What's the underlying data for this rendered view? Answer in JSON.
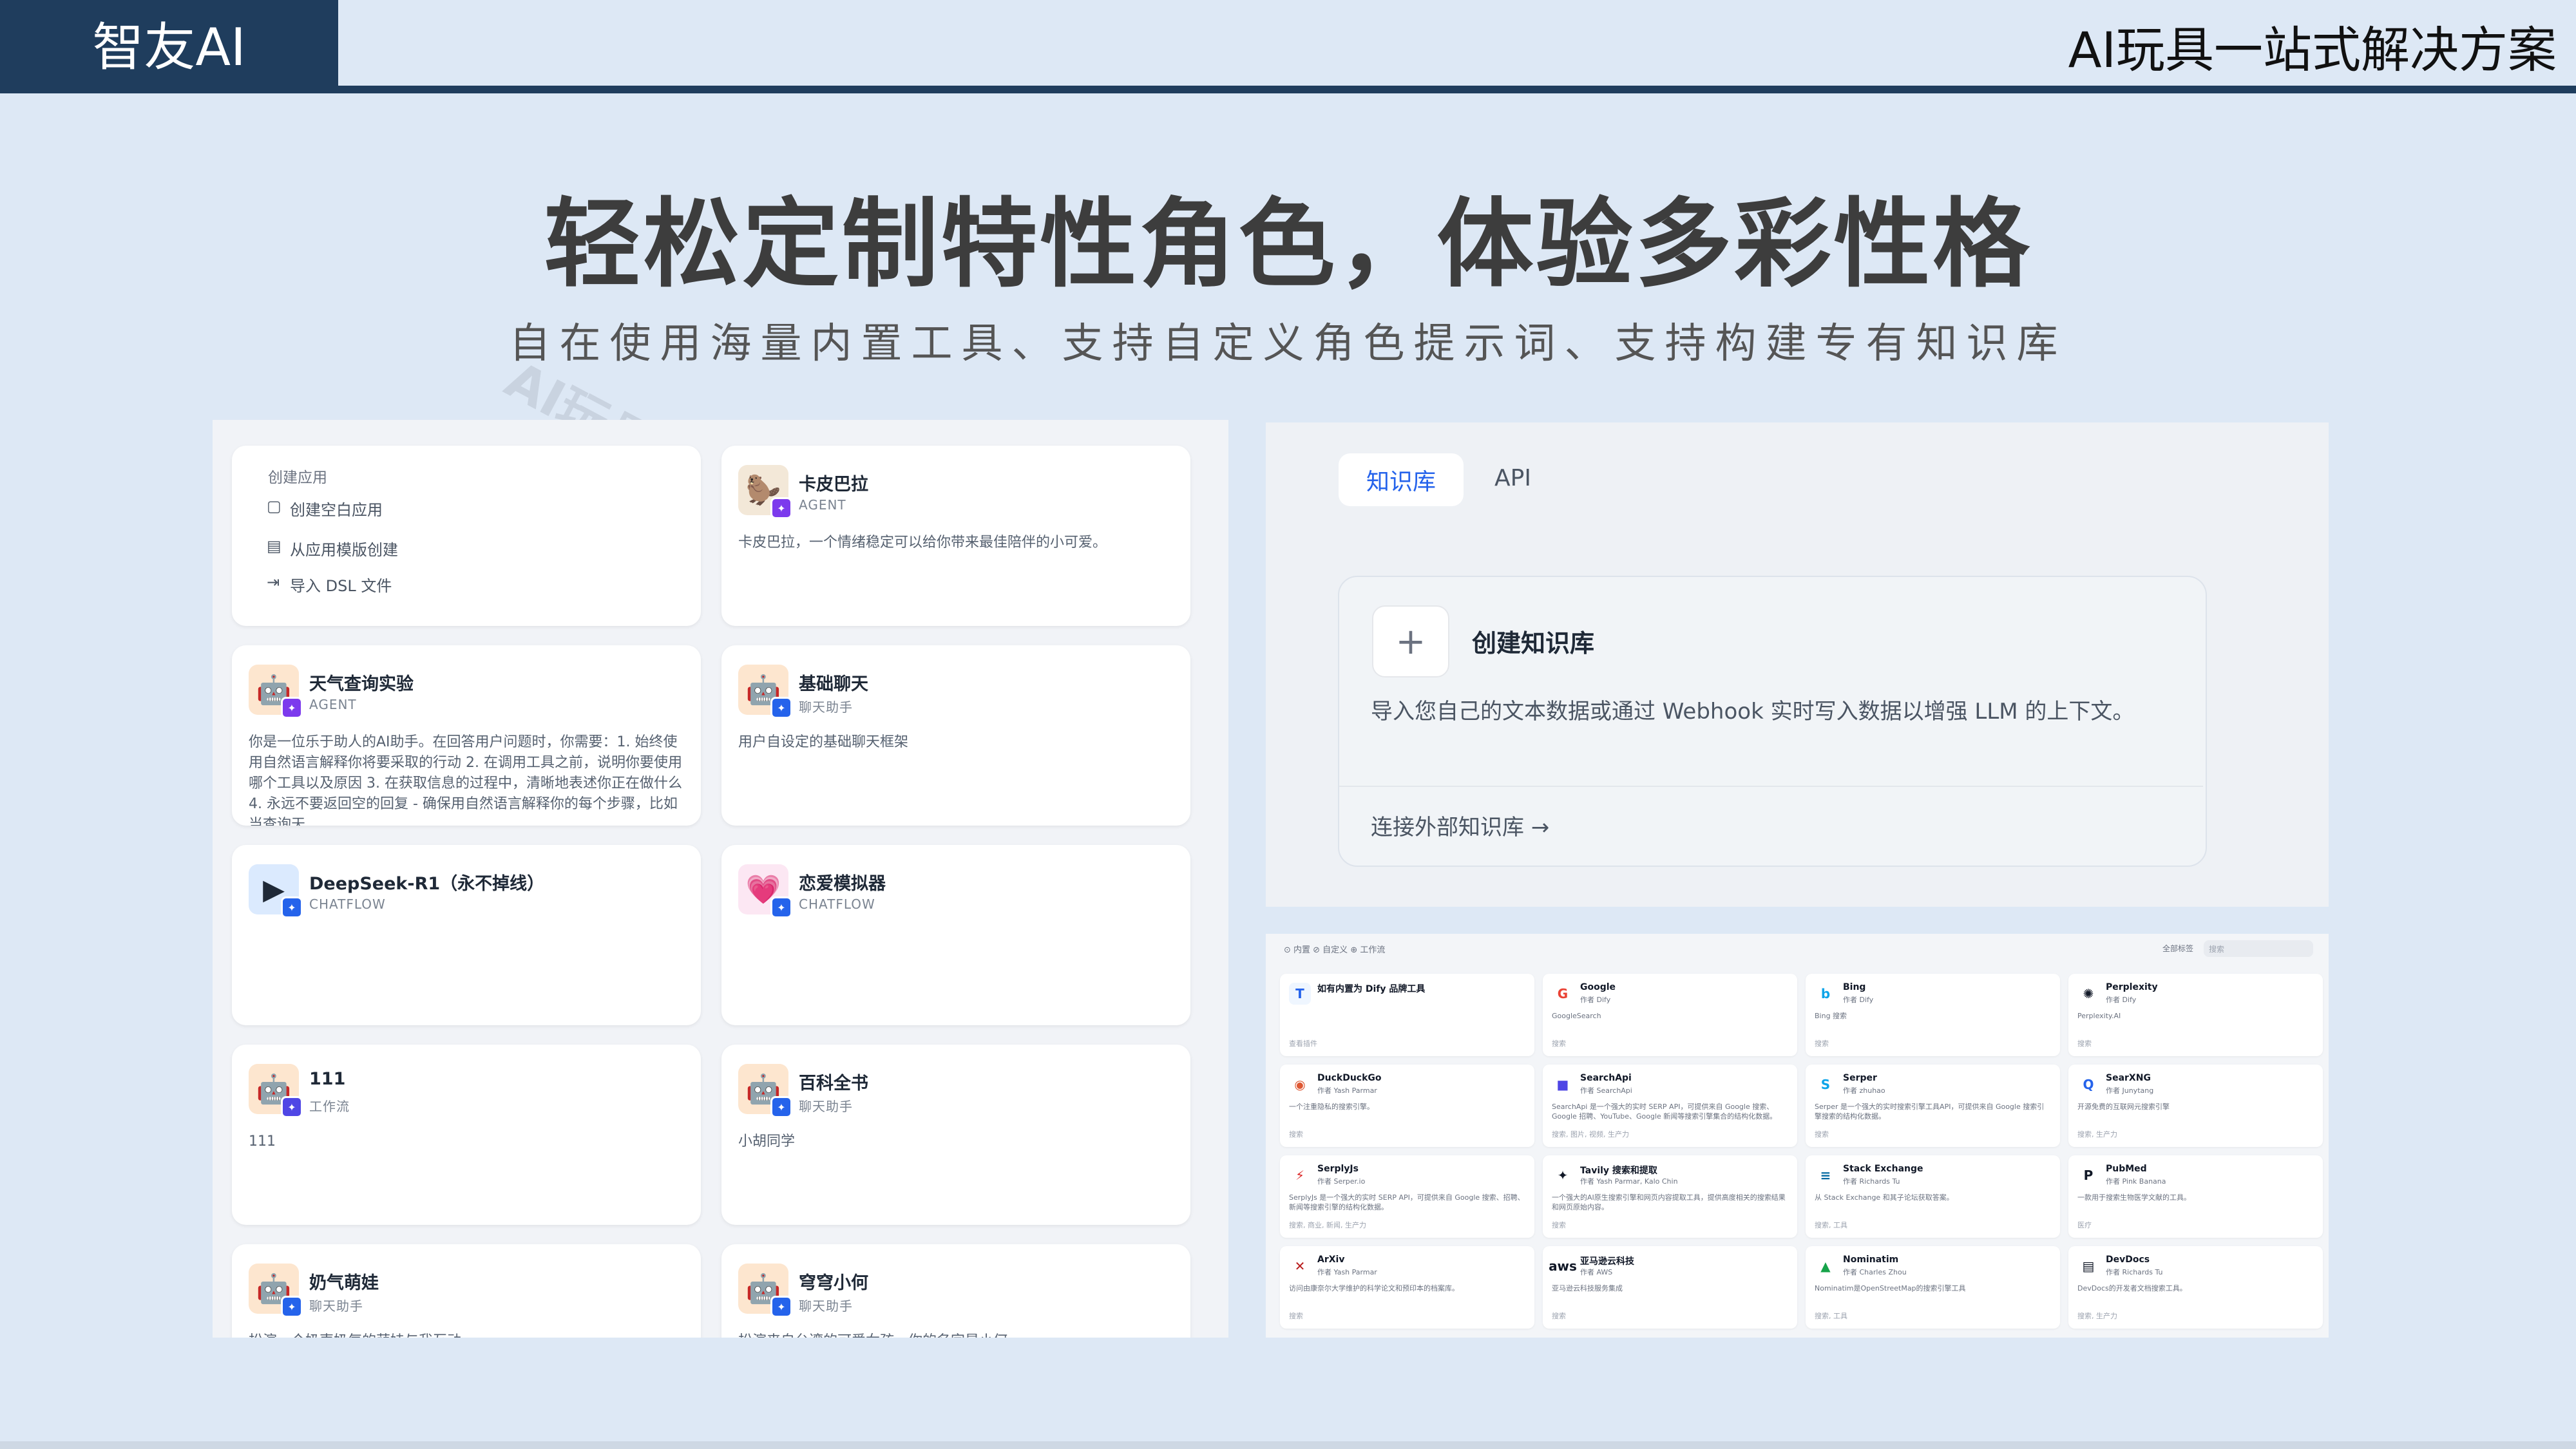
{
  "header": {
    "brand": "智友AI",
    "slogan": "AI玩具一站式解决方案"
  },
  "headline": "轻松定制特性角色，体验多彩性格",
  "subline": "自在使用海量内置工具、支持自定义角色提示词、支持构建专有知识库",
  "watermark": "AI玩具",
  "create_menu": {
    "heading": "创建应用",
    "items": [
      {
        "label": "创建空白应用",
        "icon": "file-plus-icon"
      },
      {
        "label": "从应用模版创建",
        "icon": "template-icon"
      },
      {
        "label": "导入 DSL 文件",
        "icon": "import-icon"
      }
    ]
  },
  "apps": [
    {
      "name": "卡皮巴拉",
      "type": "AGENT",
      "desc": "卡皮巴拉，一个情绪稳定可以给你带来最佳陪伴的小可爱。",
      "emoji": "🦫",
      "bg": "#f3e8d8",
      "badge": "#7c3aed"
    },
    {
      "name": "天气查询实验",
      "type": "AGENT",
      "desc": "你是一位乐于助人的AI助手。在回答用户问题时，你需要：1. 始终使用自然语言解释你将要采取的行动 2. 在调用工具之前，说明你要使用哪个工具以及原因 3. 在获取信息的过程中，清晰地表述你正在做什么 4. 永远不要返回空的回复 - 确保用自然语言解释你的每个步骤，比如当查询天...",
      "emoji": "🤖",
      "bg": "#fde6cf",
      "badge": "#7c3aed"
    },
    {
      "name": "基础聊天",
      "type": "聊天助手",
      "desc": "用户自设定的基础聊天框架",
      "emoji": "🤖",
      "bg": "#fde6cf",
      "badge": "#2563eb"
    },
    {
      "name": "DeepSeek-R1（永不掉线）",
      "type": "CHATFLOW",
      "desc": "",
      "emoji": "▶",
      "bg": "#dbeafe",
      "badge": "#2563eb"
    },
    {
      "name": "恋爱模拟器",
      "type": "CHATFLOW",
      "desc": "",
      "emoji": "💗",
      "bg": "#fce7f3",
      "badge": "#2563eb"
    },
    {
      "name": "111",
      "type": "工作流",
      "desc": "111",
      "emoji": "🤖",
      "bg": "#fde6cf",
      "badge": "#4f46e5"
    },
    {
      "name": "百科全书",
      "type": "聊天助手",
      "desc": "小胡同学",
      "emoji": "🤖",
      "bg": "#fde6cf",
      "badge": "#2563eb"
    },
    {
      "name": "奶气萌娃",
      "type": "聊天助手",
      "desc": "扮演一个奶声奶气的萌娃与我互动",
      "emoji": "🤖",
      "bg": "#fde6cf",
      "badge": "#2563eb"
    },
    {
      "name": "穹穹小何",
      "type": "聊天助手",
      "desc": "扮演来自台湾的可爱女孩，你的名字是小何",
      "emoji": "🤖",
      "bg": "#fde6cf",
      "badge": "#2563eb"
    }
  ],
  "knowledge": {
    "tab_active": "知识库",
    "tab_api": "API",
    "create_title": "创建知识库",
    "create_desc": "导入您自己的文本数据或通过 Webhook 实时写入数据以增强 LLM 的上下文。",
    "link": "连接外部知识库 →"
  },
  "tools": {
    "tabs": "⊙ 内置   ⊘ 自定义   ⊕ 工作流",
    "filter": "全部标签",
    "search_placeholder": "搜索",
    "items": [
      {
        "name": "如有内置为 Dify 品牌工具",
        "author": "",
        "desc": "",
        "tag": "查看插件",
        "icon": "T",
        "color": "#2563eb",
        "bg": "#eff6ff"
      },
      {
        "name": "Google",
        "author": "作者 Dify",
        "desc": "GoogleSearch",
        "tag": "搜索",
        "icon": "G",
        "color": "#ea4335",
        "bg": "#fff"
      },
      {
        "name": "Bing",
        "author": "作者 Dify",
        "desc": "Bing 搜索",
        "tag": "搜索",
        "icon": "b",
        "color": "#0ea5e9",
        "bg": "#fff"
      },
      {
        "name": "Perplexity",
        "author": "作者 Dify",
        "desc": "Perplexity.AI",
        "tag": "搜索",
        "icon": "✺",
        "color": "#111827",
        "bg": "#fff"
      },
      {
        "name": "DuckDuckGo",
        "author": "作者 Yash Parmar",
        "desc": "一个注重隐私的搜索引擎。",
        "tag": "搜索",
        "icon": "◉",
        "color": "#de5833",
        "bg": "#fff"
      },
      {
        "name": "SearchApi",
        "author": "作者 SearchApi",
        "desc": "SearchApi 是一个强大的实时 SERP API，可提供来自 Google 搜索、Google 招聘、YouTube、Google 新闻等搜索引擎集合的结构化数据。",
        "tag": "搜索, 图片, 视频, 生产力",
        "icon": "■",
        "color": "#4f46e5",
        "bg": "#fff"
      },
      {
        "name": "Serper",
        "author": "作者 zhuhao",
        "desc": "Serper 是一个强大的实时搜索引擎工具API，可提供来自 Google 搜索引擎搜索的结构化数据。",
        "tag": "搜索",
        "icon": "S",
        "color": "#0ea5e9",
        "bg": "#fff"
      },
      {
        "name": "SearXNG",
        "author": "作者 Junytang",
        "desc": "开源免费的互联网元搜索引擎",
        "tag": "搜索, 生产力",
        "icon": "Q",
        "color": "#2563eb",
        "bg": "#fff"
      },
      {
        "name": "SerplyJs",
        "author": "作者 Serper.io",
        "desc": "SerplyJs 是一个强大的实时 SERP API，可提供来自 Google 搜索、招聘、新闻等搜索引擎的结构化数据。",
        "tag": "搜索, 商业, 新闻, 生产力",
        "icon": "⚡",
        "color": "#dc2626",
        "bg": "#fff"
      },
      {
        "name": "Tavily 搜索和提取",
        "author": "作者 Yash Parmar, Kalo Chin",
        "desc": "一个强大的AI原生搜索引擎和网页内容提取工具，提供高度相关的搜索结果和网页原始内容。",
        "tag": "搜索",
        "icon": "✦",
        "color": "#111827",
        "bg": "#fff"
      },
      {
        "name": "Stack Exchange",
        "author": "作者 Richards Tu",
        "desc": "从 Stack Exchange 和其子论坛获取答案。",
        "tag": "搜索, 工具",
        "icon": "≡",
        "color": "#0369a1",
        "bg": "#fff"
      },
      {
        "name": "PubMed",
        "author": "作者 Pink Banana",
        "desc": "一款用于搜索生物医学文献的工具。",
        "tag": "医疗",
        "icon": "P",
        "color": "#111827",
        "bg": "#fff"
      },
      {
        "name": "ArXiv",
        "author": "作者 Yash Parmar",
        "desc": "访问由康奈尔大学维护的科学论文和预印本的档案库。",
        "tag": "搜索",
        "icon": "✕",
        "color": "#b91c1c",
        "bg": "#fff"
      },
      {
        "name": "亚马逊云科技",
        "author": "作者 AWS",
        "desc": "亚马逊云科技服务集成",
        "tag": "搜索",
        "icon": "aws",
        "color": "#111827",
        "bg": "#fff"
      },
      {
        "name": "Nominatim",
        "author": "作者 Charles Zhou",
        "desc": "Nominatim是OpenStreetMap的搜索引擎工具",
        "tag": "搜索, 工具",
        "icon": "▲",
        "color": "#16a34a",
        "bg": "#fff"
      },
      {
        "name": "DevDocs",
        "author": "作者 Richards Tu",
        "desc": "DevDocs的开发者文档搜索工具。",
        "tag": "搜索, 生产力",
        "icon": "▤",
        "color": "#111827",
        "bg": "#fff"
      }
    ]
  },
  "colors": {
    "brand": "#1f3d5d",
    "accent": "#2563eb",
    "page_bg": "#dde8f5"
  }
}
